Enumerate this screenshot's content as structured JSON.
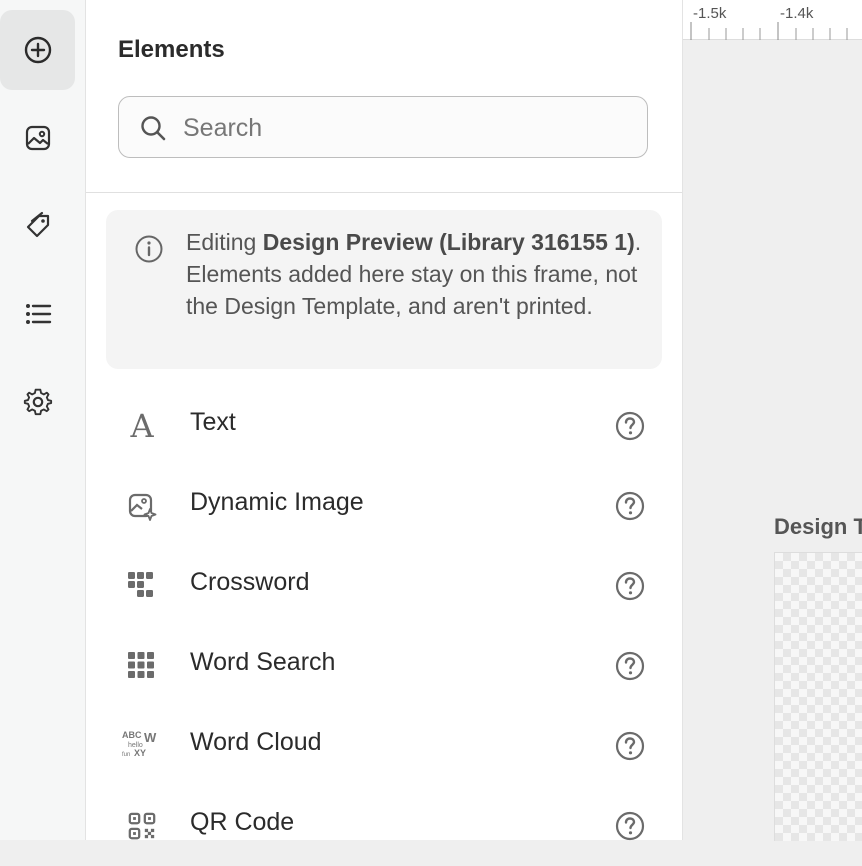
{
  "rail": {
    "items": [
      {
        "name": "add-element",
        "icon": "plus-circle-icon",
        "active": true
      },
      {
        "name": "images",
        "icon": "image-icon",
        "active": false
      },
      {
        "name": "tags",
        "icon": "tag-icon",
        "active": false
      },
      {
        "name": "list",
        "icon": "list-icon",
        "active": false
      },
      {
        "name": "settings",
        "icon": "gear-icon",
        "active": false
      }
    ]
  },
  "panel": {
    "title": "Elements",
    "search": {
      "placeholder": "Search",
      "value": ""
    },
    "info": {
      "prefix": "Editing ",
      "bold": "Design Preview (Library 316155 1)",
      "suffix": ". Elements added here stay on this frame, not the Design Template, and aren't printed."
    },
    "items": [
      {
        "label": "Text",
        "icon": "text-icon"
      },
      {
        "label": "Dynamic Image",
        "icon": "dynamic-image-icon"
      },
      {
        "label": "Crossword",
        "icon": "crossword-icon"
      },
      {
        "label": "Word Search",
        "icon": "word-search-icon"
      },
      {
        "label": "Word Cloud",
        "icon": "word-cloud-icon",
        "icon_text": [
          "ABC",
          "W",
          "hello",
          "fun",
          "XY"
        ]
      },
      {
        "label": "QR Code",
        "icon": "qr-code-icon"
      }
    ]
  },
  "canvas": {
    "ruler_labels": [
      "-1.5k",
      "-1.4k"
    ],
    "frame_title": "Design T"
  }
}
